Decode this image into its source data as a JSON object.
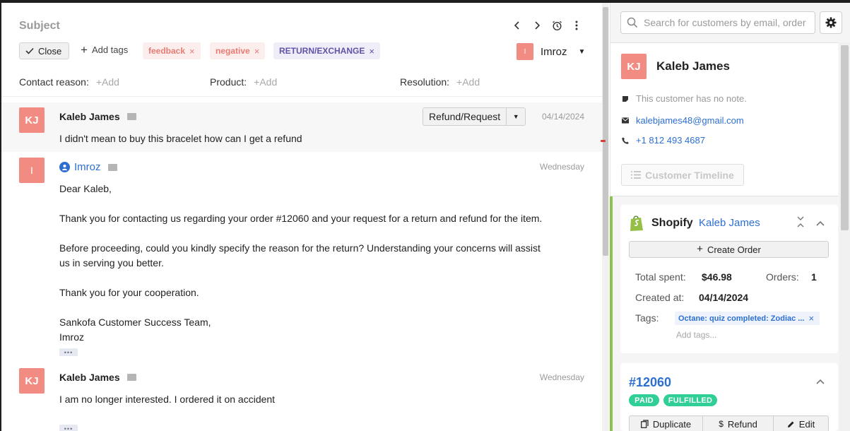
{
  "ticket": {
    "subject": "Subject",
    "close_label": "Close",
    "add_tags_label": "Add tags",
    "tags": [
      "feedback",
      "negative",
      "RETURN/EXCHANGE"
    ],
    "assignee": {
      "initial": "I",
      "name": "Imroz"
    },
    "fields": {
      "contact_reason_label": "Contact reason:",
      "product_label": "Product:",
      "resolution_label": "Resolution:",
      "add_label": "+Add"
    }
  },
  "messages": [
    {
      "initials": "KJ",
      "sender": "Kaleb James",
      "date": "04/14/2024",
      "intent": "Refund/Request",
      "lines": [
        "I didn't mean to buy this bracelet how can I get a refund"
      ]
    },
    {
      "initials": "I",
      "sender": "Imroz",
      "date": "Wednesday",
      "lines": [
        "Dear Kaleb,",
        "Thank you for contacting us regarding your order #12060 and your request for a return and refund for the item.",
        "Before proceeding, could you kindly specify the reason for the return? Understanding your concerns will assist",
        "us in serving you better.",
        "Thank you for your cooperation.",
        "Sankofa Customer Success Team,",
        "Imroz"
      ]
    },
    {
      "initials": "KJ",
      "sender": "Kaleb James",
      "date": "Wednesday",
      "lines": [
        "I am no longer interested. I ordered it on accident"
      ]
    }
  ],
  "sidebar": {
    "search_placeholder": "Search for customers by email, order",
    "customer": {
      "initials": "KJ",
      "name": "Kaleb James",
      "note": "This customer has no note.",
      "email": "kalebjames48@gmail.com",
      "phone": "+1 812 493 4687",
      "timeline_label": "Customer Timeline"
    },
    "shopify": {
      "title": "Shopify",
      "customer_link": "Kaleb James",
      "create_order_label": "Create Order",
      "total_spent_label": "Total spent:",
      "total_spent": "$46.98",
      "orders_label": "Orders:",
      "orders": "1",
      "created_at_label": "Created at:",
      "created_at": "04/14/2024",
      "tags_label": "Tags:",
      "tag": "Octane: quiz completed: Zodiac ...",
      "add_tags_placeholder": "Add tags..."
    },
    "order": {
      "number": "#12060",
      "payment_status": "PAID",
      "fulfillment_status": "FULFILLED",
      "duplicate_label": "Duplicate",
      "refund_label": "Refund",
      "edit_label": "Edit"
    }
  },
  "colors": {
    "avatar": "#f28b82",
    "link": "#2c6fd1",
    "badge": "#2fcf96",
    "shopify_green": "#95bf47"
  }
}
